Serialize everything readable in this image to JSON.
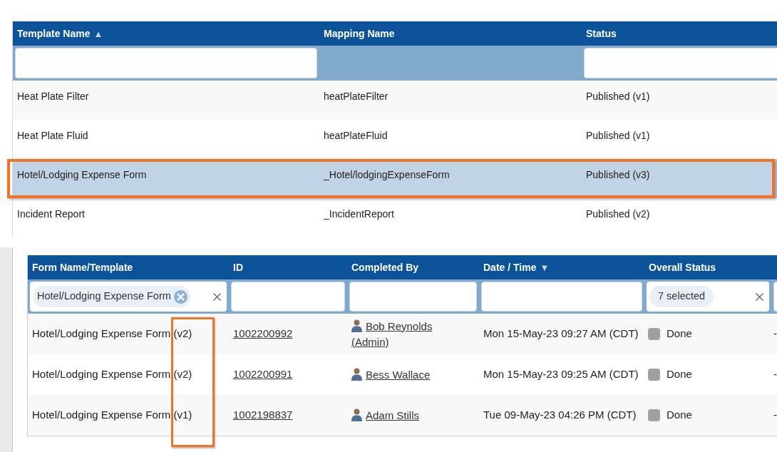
{
  "templates_table": {
    "columns": [
      {
        "label": "Template Name",
        "sort_indicator": "▲"
      },
      {
        "label": "Mapping Name"
      },
      {
        "label": "Status"
      }
    ],
    "filters": [
      {
        "kind": "input"
      },
      {
        "kind": "blank"
      },
      {
        "kind": "input"
      }
    ],
    "rows": [
      {
        "template_name": "Heat Plate Filter",
        "mapping_name": "heatPlateFilter",
        "status": "Published (v1)",
        "selected": false
      },
      {
        "template_name": "Heat Plate Fluid",
        "mapping_name": "heatPlateFluid",
        "status": "Published (v1)",
        "selected": false
      },
      {
        "template_name": "Hotel/Lodging Expense Form",
        "mapping_name": "_Hotel/lodgingExpenseForm",
        "status": "Published (v3)",
        "selected": true
      },
      {
        "template_name": "Incident Report",
        "mapping_name": "_IncidentReport",
        "status": "Published (v2)",
        "selected": false
      }
    ]
  },
  "forms_table": {
    "columns": [
      {
        "label": "Form Name/Template"
      },
      {
        "label": "ID"
      },
      {
        "label": "Completed By"
      },
      {
        "label": "Date / Time",
        "sort_indicator": "▼"
      },
      {
        "label": "Overall Status"
      }
    ],
    "filters": [
      {
        "kind": "chips",
        "chips": [
          {
            "label": "Hotel/Lodging Expense Form",
            "removable": true
          }
        ],
        "clearable": true
      },
      {
        "kind": "input"
      },
      {
        "kind": "input"
      },
      {
        "kind": "input"
      },
      {
        "kind": "chips",
        "chips": [
          {
            "label": "7 selected",
            "removable": false
          }
        ],
        "clearable": true
      },
      {
        "kind": "input"
      }
    ],
    "rows": [
      {
        "form_name": "Hotel/Lodging Expense Form (v2)",
        "id": "1002200992",
        "completed_by": "Bob Reynolds (Admin)",
        "date_time": "Mon 15-May-23 09:27 AM (CDT)",
        "status": {
          "label": "Done",
          "color": "#a0a0a0"
        },
        "column_6": "-"
      },
      {
        "form_name": "Hotel/Lodging Expense Form (v2)",
        "id": "1002200991",
        "completed_by": "Bess Wallace",
        "date_time": "Mon 15-May-23 09:25 AM (CDT)",
        "status": {
          "label": "Done",
          "color": "#a0a0a0"
        },
        "column_6": "-"
      },
      {
        "form_name": "Hotel/Lodging Expense Form (v1)",
        "id": "1002198837",
        "completed_by": "Adam Stills",
        "date_time": "Tue 09-May-23 04:26 PM (CDT)",
        "status": {
          "label": "Done",
          "color": "#a0a0a0"
        },
        "column_6": "-"
      }
    ]
  }
}
